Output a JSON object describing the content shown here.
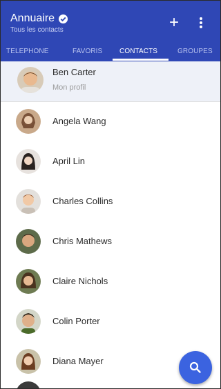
{
  "appbar": {
    "title": "Annuaire",
    "subtitle": "Tous les contacts",
    "add_icon": "plus-icon",
    "more_icon": "more-vertical-icon"
  },
  "tabs": [
    {
      "label": "TELEPHONE",
      "active": false
    },
    {
      "label": "FAVORIS",
      "active": false
    },
    {
      "label": "CONTACTS",
      "active": true
    },
    {
      "label": "GROUPES",
      "active": false
    }
  ],
  "me": {
    "name": "Ben Carter",
    "label": "Mon profil"
  },
  "contacts": [
    {
      "name": "Angela Wang"
    },
    {
      "name": "April Lin"
    },
    {
      "name": "Charles Collins"
    },
    {
      "name": "Chris Mathews"
    },
    {
      "name": "Claire Nichols"
    },
    {
      "name": "Colin Porter"
    },
    {
      "name": "Diana Mayer"
    }
  ],
  "fab": {
    "icon": "search-icon"
  },
  "colors": {
    "appbar": "#2f47b5",
    "fab": "#3b63e0",
    "me_row": "#eef1f8"
  }
}
